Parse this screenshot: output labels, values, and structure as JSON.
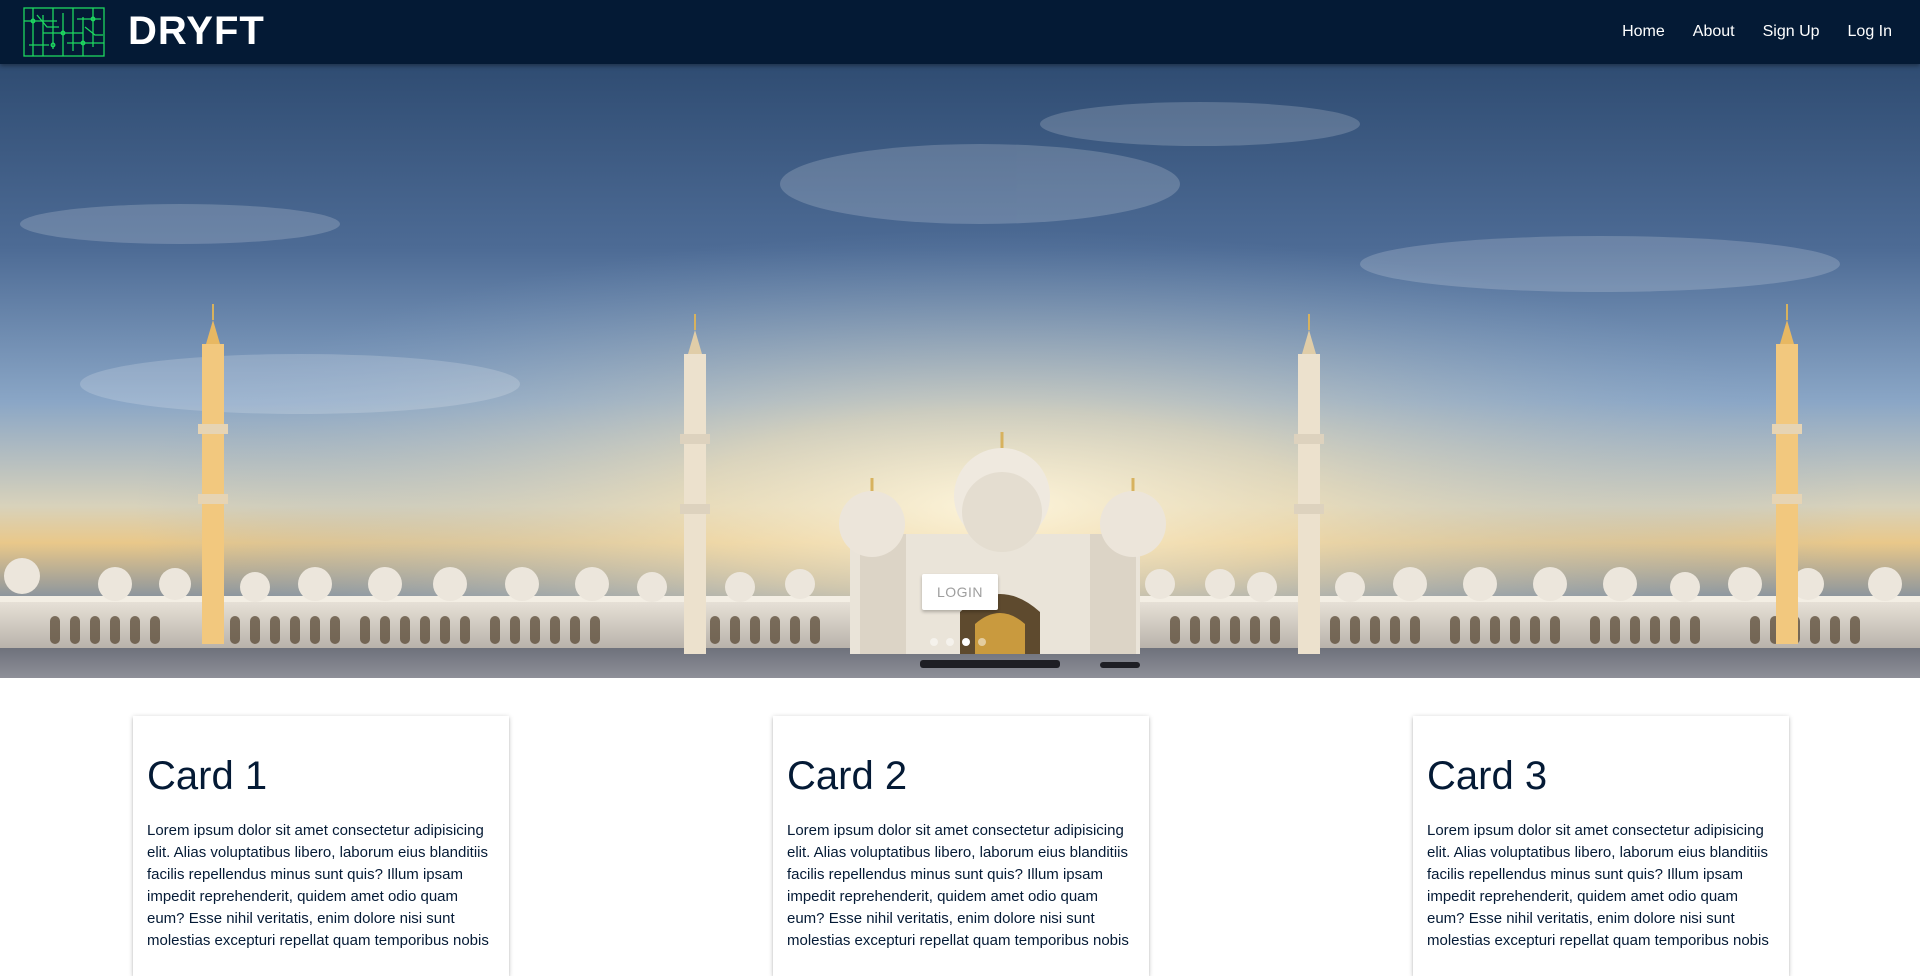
{
  "navbar": {
    "brand": "DRYFT",
    "logo_icon": "circuit-grid-logo",
    "links": [
      "Home",
      "About",
      "Sign Up",
      "Log In"
    ]
  },
  "hero": {
    "login_label": "LOGIN",
    "slide_count": 4,
    "active_slide": 3
  },
  "cards": [
    {
      "title": "Card 1",
      "text": "Lorem ipsum dolor sit amet consectetur adipisicing elit. Alias voluptatibus libero, laborum eius blanditiis facilis repellendus minus sunt quis? Illum ipsam impedit reprehenderit, quidem amet odio quam eum? Esse nihil veritatis, enim dolore nisi sunt molestias excepturi repellat quam temporibus nobis"
    },
    {
      "title": "Card 2",
      "text": "Lorem ipsum dolor sit amet consectetur adipisicing elit. Alias voluptatibus libero, laborum eius blanditiis facilis repellendus minus sunt quis? Illum ipsam impedit reprehenderit, quidem amet odio quam eum? Esse nihil veritatis, enim dolore nisi sunt molestias excepturi repellat quam temporibus nobis"
    },
    {
      "title": "Card 3",
      "text": "Lorem ipsum dolor sit amet consectetur adipisicing elit. Alias voluptatibus libero, laborum eius blanditiis facilis repellendus minus sunt quis? Illum ipsam impedit reprehenderit, quidem amet odio quam eum? Esse nihil veritatis, enim dolore nisi sunt molestias excepturi repellat quam temporibus nobis"
    }
  ],
  "colors": {
    "navbar_bg": "#041a35",
    "logo_green": "#1ed760",
    "text_dark": "#041a35"
  }
}
